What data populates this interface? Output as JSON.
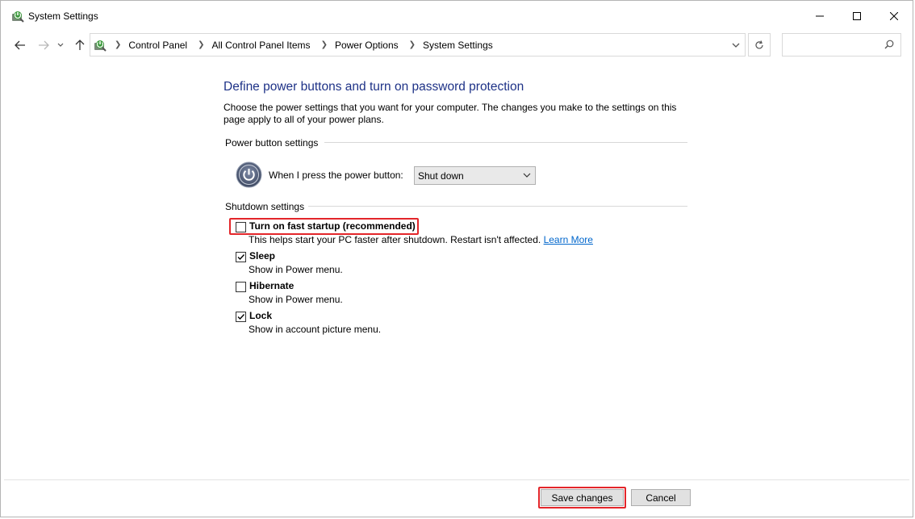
{
  "window": {
    "title": "System Settings",
    "icon": "power-options-icon"
  },
  "addressbar": {
    "crumbs": [
      "Control Panel",
      "All Control Panel Items",
      "Power Options",
      "System Settings"
    ],
    "search_placeholder": ""
  },
  "content": {
    "heading": "Define power buttons and turn on password protection",
    "description": "Choose the power settings that you want for your computer. The changes you make to the settings on this page apply to all of your power plans.",
    "power_group_label": "Power button settings",
    "power_button_label": "When I press the power button:",
    "power_button_value": "Shut down",
    "shutdown_group_label": "Shutdown settings",
    "options": [
      {
        "label": "Turn on fast startup (recommended)",
        "desc": "This helps start your PC faster after shutdown. Restart isn't affected.",
        "link": "Learn More",
        "checked": false,
        "highlighted": true
      },
      {
        "label": "Sleep",
        "desc": "Show in Power menu.",
        "checked": true
      },
      {
        "label": "Hibernate",
        "desc": "Show in Power menu.",
        "checked": false
      },
      {
        "label": "Lock",
        "desc": "Show in account picture menu.",
        "checked": true
      }
    ]
  },
  "footer": {
    "save_label": "Save changes",
    "cancel_label": "Cancel"
  },
  "colors": {
    "heading": "#1e3287",
    "highlight": "#e3262a",
    "link": "#0066cc"
  }
}
